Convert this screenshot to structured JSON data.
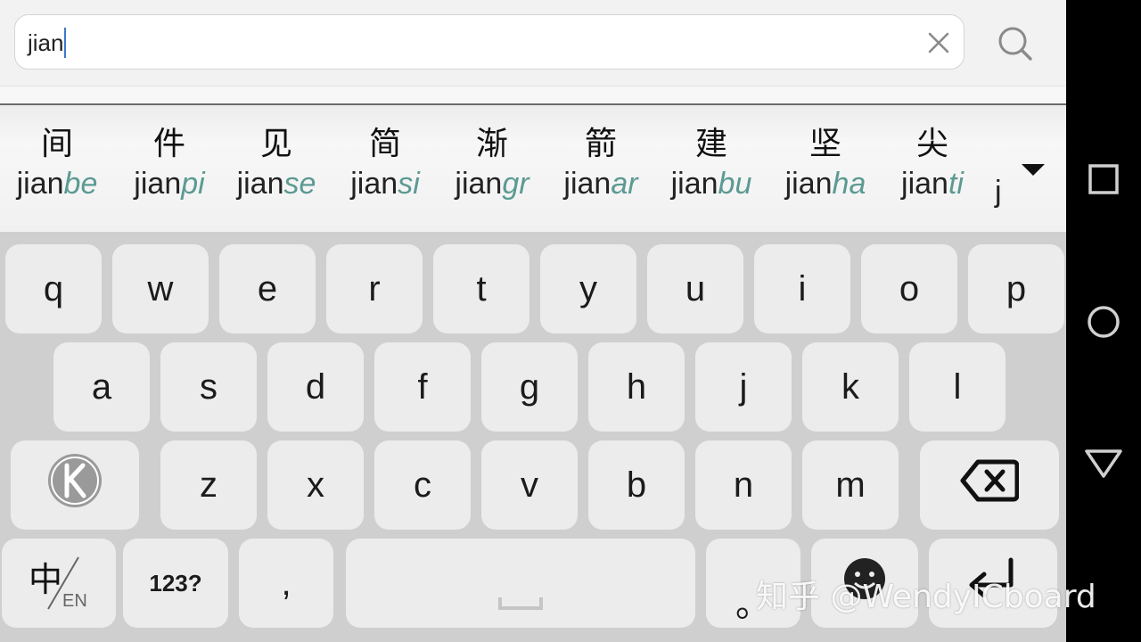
{
  "search": {
    "value": "jian"
  },
  "icons": {
    "clear": "close-icon",
    "search": "search-icon",
    "expand": "chevron-down-icon",
    "logo": "keyboard-logo-icon",
    "backspace": "backspace-icon",
    "lang": "language-switch-icon",
    "emoji": "emoji-icon",
    "enter": "enter-icon",
    "nav_recent": "square-icon",
    "nav_home": "circle-icon",
    "nav_back": "triangle-icon"
  },
  "colors": {
    "pinyin_suffix": "#5b9a93",
    "caret": "#3b78c8",
    "key_bg": "#ececec",
    "keyboard_bg": "#cfcfcf",
    "navbar_bg": "#000000"
  },
  "candidates": [
    {
      "hanzi": "间",
      "base": "jian",
      "suffix": "be"
    },
    {
      "hanzi": "件",
      "base": "jian",
      "suffix": "pi"
    },
    {
      "hanzi": "见",
      "base": "jian",
      "suffix": "se"
    },
    {
      "hanzi": "简",
      "base": "jian",
      "suffix": "si"
    },
    {
      "hanzi": "渐",
      "base": "jian",
      "suffix": "gr"
    },
    {
      "hanzi": "箭",
      "base": "jian",
      "suffix": "ar"
    },
    {
      "hanzi": "建",
      "base": "jian",
      "suffix": "bu"
    },
    {
      "hanzi": "坚",
      "base": "jian",
      "suffix": "ha"
    },
    {
      "hanzi": "尖",
      "base": "jian",
      "suffix": "ti"
    }
  ],
  "candidate_partial": "j",
  "keys": {
    "row1": [
      "q",
      "w",
      "e",
      "r",
      "t",
      "y",
      "u",
      "i",
      "o",
      "p"
    ],
    "row2": [
      "a",
      "s",
      "d",
      "f",
      "g",
      "h",
      "j",
      "k",
      "l"
    ],
    "row3": [
      "z",
      "x",
      "c",
      "v",
      "b",
      "n",
      "m"
    ],
    "lang_main": "中",
    "lang_sub": "EN",
    "numbers": "123?",
    "comma": ",",
    "period": "。"
  },
  "watermark": "知乎 @WendyICboard"
}
